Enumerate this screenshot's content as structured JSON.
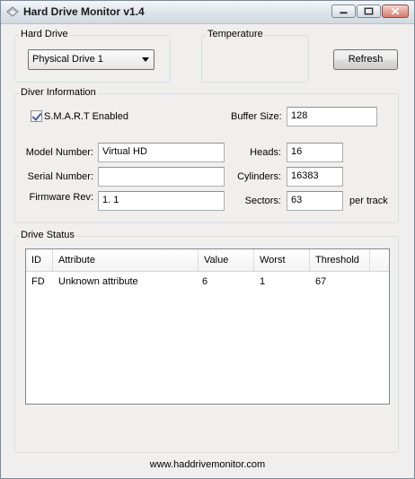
{
  "window": {
    "title": "Hard Drive Monitor v1.4"
  },
  "hard_drive": {
    "group_label": "Hard Drive",
    "selected_drive": "Physical Drive 1"
  },
  "temperature": {
    "group_label": "Temperature"
  },
  "refresh_label": "Refresh",
  "drive_info": {
    "group_label": "Diver Information",
    "smart_label": "S.M.A.R.T Enabled",
    "smart_enabled": true,
    "model_label": "Model Number:",
    "model_value": "Virtual HD",
    "serial_label": "Serial Number:",
    "serial_value": "",
    "firmware_label": "Firmware Rev:",
    "firmware_value": "1. 1",
    "buffer_label": "Buffer Size:",
    "buffer_value": "128",
    "heads_label": "Heads:",
    "heads_value": "16",
    "cylinders_label": "Cylinders:",
    "cylinders_value": "16383",
    "sectors_label": "Sectors:",
    "sectors_value": "63",
    "per_track_label": "per track"
  },
  "drive_status": {
    "group_label": "Drive Status",
    "columns": [
      "ID",
      "Attribute",
      "Value",
      "Worst",
      "Threshold"
    ],
    "rows": [
      {
        "id": "FD",
        "attribute": "Unknown attribute",
        "value": "6",
        "worst": "1",
        "threshold": "67"
      }
    ]
  },
  "footer_link": "www.haddrivemonitor.com",
  "colors": {
    "window_bg": "#f0efed",
    "group_border": "#d5dfe5",
    "checkmark": "#4a5f97",
    "close_button": "#d77e6f"
  }
}
